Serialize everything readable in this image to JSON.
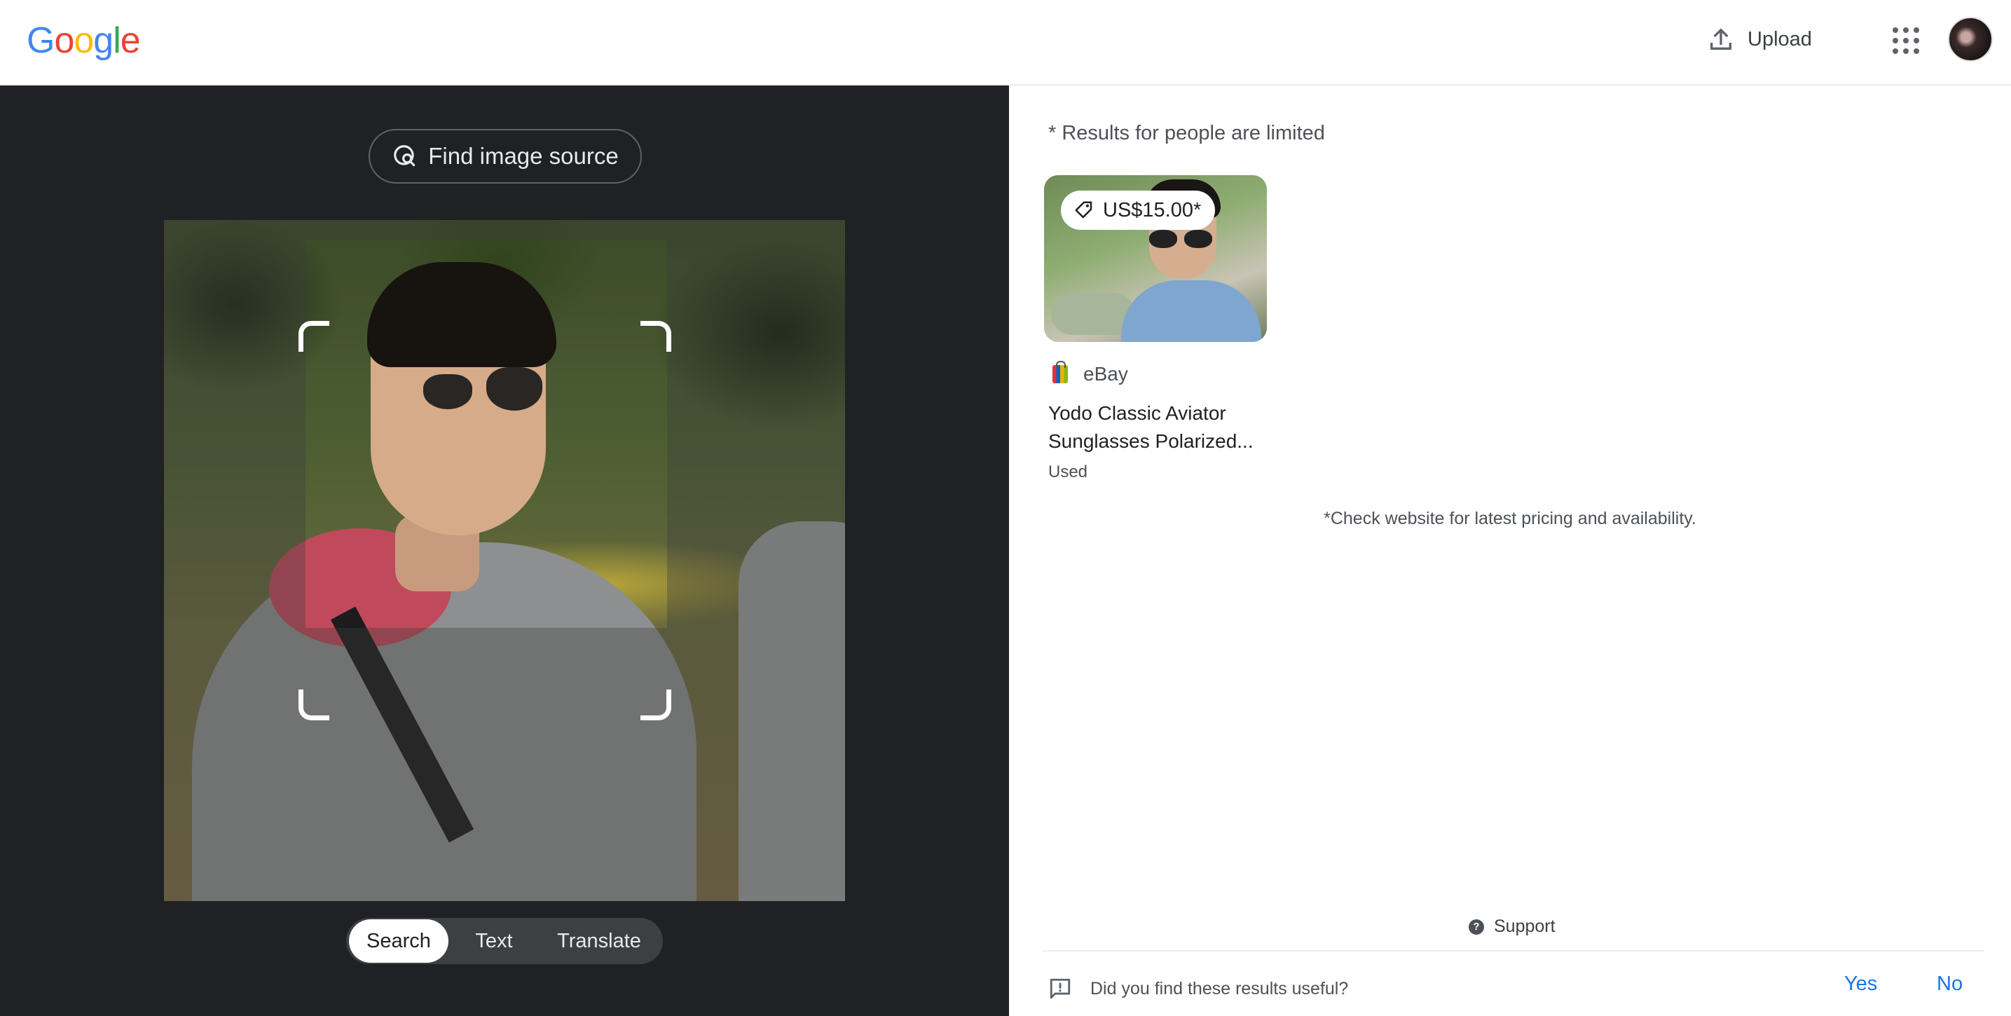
{
  "header": {
    "logo_letters": [
      "G",
      "o",
      "o",
      "g",
      "l",
      "e"
    ],
    "upload_label": "Upload"
  },
  "lens": {
    "find_source_label": "Find image source",
    "modes": [
      "Search",
      "Text",
      "Translate"
    ],
    "active_mode": "Search"
  },
  "results": {
    "notice": "* Results for people are limited",
    "items": [
      {
        "price": "US$15.00*",
        "seller": "eBay",
        "title_line1": "Yodo Classic Aviator",
        "title_line2": "Sunglasses Polarized...",
        "condition": "Used"
      }
    ],
    "disclaimer": "*Check website for latest pricing and availability."
  },
  "footer": {
    "support_label": "Support",
    "feedback_question": "Did you find these results useful?",
    "yes_label": "Yes",
    "no_label": "No"
  },
  "colors": {
    "accent": "#1a73e8",
    "dark_panel": "#202124",
    "logo_blue": "#4285f4",
    "logo_red": "#ea4335",
    "logo_yellow": "#fbbc05",
    "logo_green": "#34a853"
  }
}
